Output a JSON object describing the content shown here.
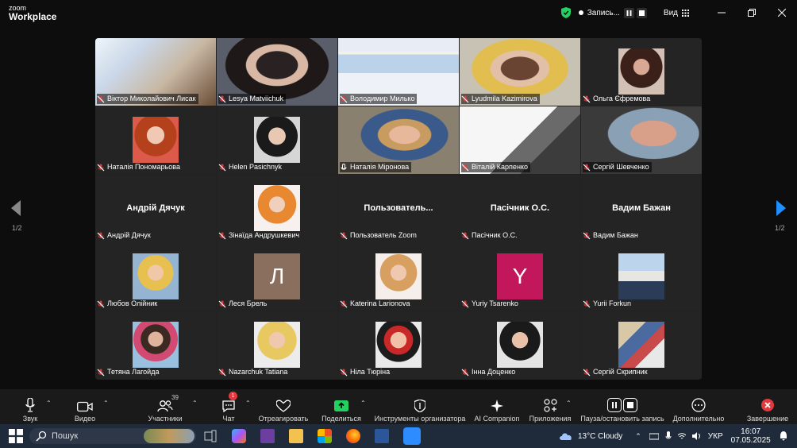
{
  "app": {
    "logo_top": "zoom",
    "logo_bottom": "Workplace"
  },
  "titlebar": {
    "recording_label": "Запись...",
    "view_label": "Вид",
    "colors": {
      "shield": "#23d160"
    }
  },
  "gallery": {
    "page_indicator": "1/2",
    "tiles": [
      {
        "name": "Віктор Миколайович Лисак",
        "kind": "video",
        "label_bg": true
      },
      {
        "name": "Lesya Matviichuk",
        "kind": "video",
        "label_bg": true
      },
      {
        "name": "Володимир Милько",
        "kind": "video",
        "label_bg": true
      },
      {
        "name": "Lyudmila Kazimirova",
        "kind": "video",
        "label_bg": true
      },
      {
        "name": "Ольга Єфремова",
        "kind": "photo"
      },
      {
        "name": "Наталія Пономарьова",
        "kind": "photo"
      },
      {
        "name": "Helen Pasichnyk",
        "kind": "photo"
      },
      {
        "name": "Наталія Міронова",
        "kind": "video",
        "active": true,
        "unmuted": true,
        "label_bg": true
      },
      {
        "name": "Віталій Карпенко",
        "kind": "video",
        "label_bg": true
      },
      {
        "name": "Сергій Шевченко",
        "kind": "video",
        "label_bg": true
      },
      {
        "name": "Андрій Дячук",
        "kind": "text",
        "center": "Андрій Дячук"
      },
      {
        "name": "Зінаїда Андрушкевич",
        "kind": "photo"
      },
      {
        "name": "Пользователь Zoom",
        "kind": "text",
        "center": "Пользователь..."
      },
      {
        "name": "Пасічник О.С.",
        "kind": "text",
        "center": "Пасічник О.С."
      },
      {
        "name": "Вадим Бажан",
        "kind": "text",
        "center": "Вадим Бажан"
      },
      {
        "name": "Любов Олійник",
        "kind": "photo"
      },
      {
        "name": "Леся Брель",
        "kind": "letter",
        "letter": "Л",
        "color": "#8a6e5e"
      },
      {
        "name": "Katerina Larionova",
        "kind": "photo"
      },
      {
        "name": "Yuriy Tsarenko",
        "kind": "letter",
        "letter": "Y",
        "color": "#c2185b"
      },
      {
        "name": "Yurii Forkun",
        "kind": "photo"
      },
      {
        "name": "Тетяна Лагойда",
        "kind": "photo"
      },
      {
        "name": "Nazarchuk Tatiana",
        "kind": "photo"
      },
      {
        "name": "Ніла Тюріна",
        "kind": "photo"
      },
      {
        "name": "Інна Доценко",
        "kind": "photo"
      },
      {
        "name": "Сергій Скрипник",
        "kind": "photo"
      }
    ]
  },
  "toolbar": {
    "audio": "Звук",
    "video": "Видео",
    "participants": "Участники",
    "participants_count": "39",
    "chat": "Чат",
    "chat_badge": "1",
    "react": "Отреагировать",
    "share": "Поделиться",
    "host_tools": "Инструменты организатора",
    "ai": "AI Companion",
    "apps": "Приложения",
    "pause_record": "Пауза/остановить запись",
    "more": "Дополнительно",
    "end": "Завершение"
  },
  "taskbar": {
    "search_placeholder": "Пошук",
    "weather": "13°C  Cloudy",
    "lang": "УКР",
    "time": "16:07",
    "date": "07.05.2025"
  }
}
